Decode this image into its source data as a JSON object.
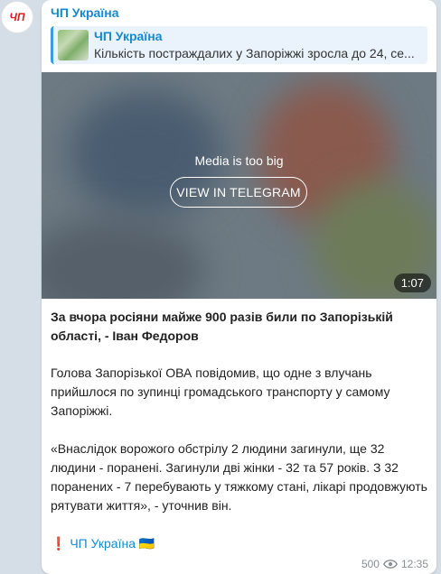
{
  "avatar": {
    "initials": "ЧП"
  },
  "post": {
    "channel": "ЧП Україна",
    "reply": {
      "title": "ЧП Україна",
      "text": "Кількість постраждалих у Запоріжжі зросла до 24, се..."
    },
    "media": {
      "message": "Media is too big",
      "button": "VIEW IN TELEGRAM",
      "duration": "1:07"
    },
    "headline": "За вчора росіяни майже 900 разів били по Запорізькій області, - Іван Федоров",
    "paragraph1": "Голова Запорізької ОВА повідомив, що одне з влучань прийшлося по зупинці громадського транспорту у самому Запоріжжі.",
    "paragraph2": "«Внаслідок ворожого обстрілу 2 людини загинули, ще 32 людини - поранені. Загинули дві жінки - 32 та 57 років. З 32 поранених - 7 перебувають у тяжкому стані, лікарі продовжують рятувати життя», - уточнив він.",
    "signature": {
      "marker": "❗",
      "name": "ЧП Україна",
      "flag": "🇺🇦"
    },
    "views": "500",
    "time": "12:35"
  },
  "colors": {
    "accent": "#168acd",
    "background": "#d5dde6",
    "avatar_text": "#d81e1e"
  },
  "icons": [
    "eye-icon"
  ]
}
